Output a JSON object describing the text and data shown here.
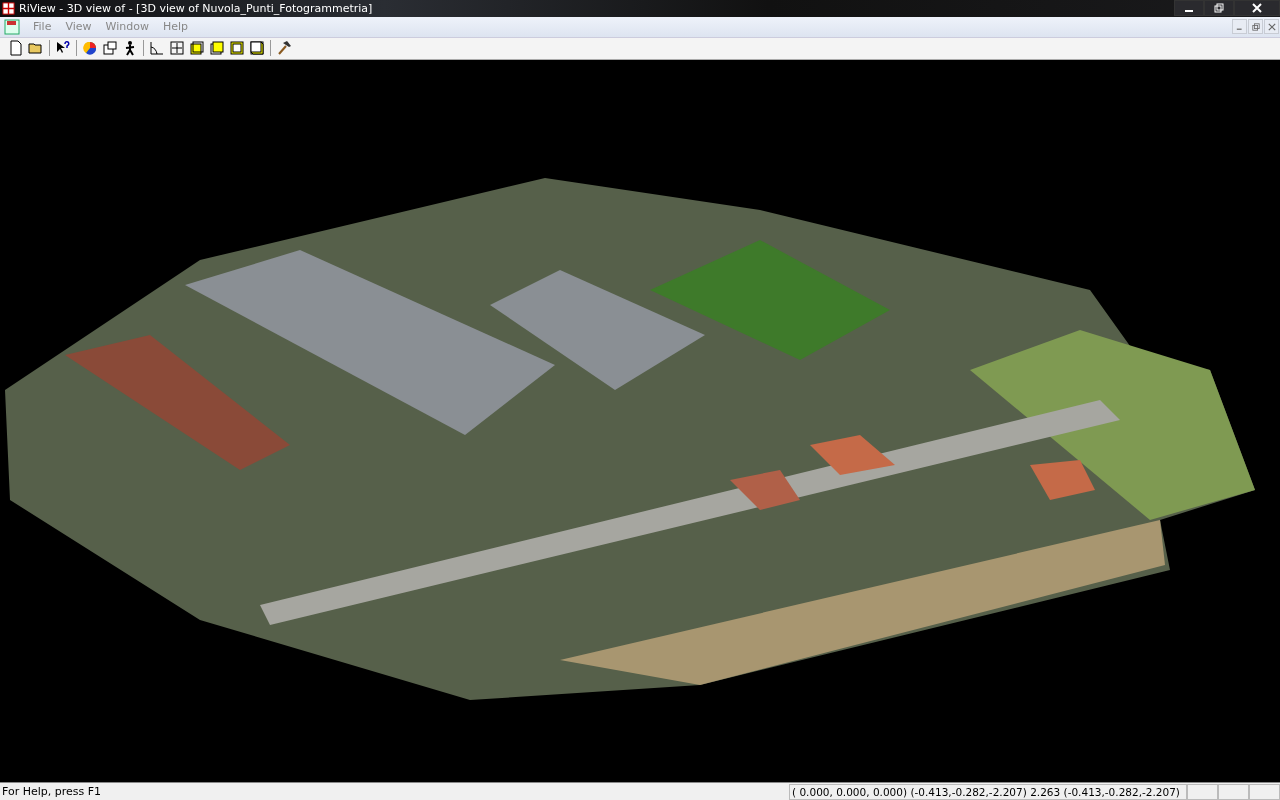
{
  "window": {
    "title": "RiView - 3D view of  - [3D view of Nuvola_Punti_Fotogrammetria]"
  },
  "menu": [
    "File",
    "View",
    "Window",
    "Help"
  ],
  "status_bar": {
    "help": "For Help, press F1",
    "coordinates": "( 0.000, 0.000, 0.000) (-0.413,-0.282,-2.207)  2.263 (-0.413,-0.282,-2.207)"
  }
}
